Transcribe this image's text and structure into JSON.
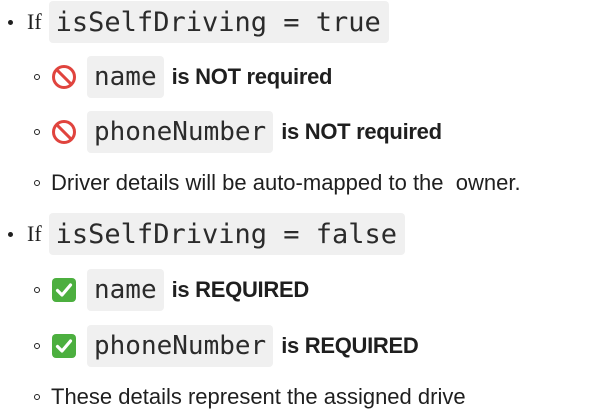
{
  "sections": [
    {
      "if_label": "If",
      "condition": "isSelfDriving = true",
      "items": [
        {
          "icon": "prohibited-icon",
          "field": "name",
          "status": "is NOT required"
        },
        {
          "icon": "prohibited-icon",
          "field": "phoneNumber",
          "status": "is NOT required"
        }
      ],
      "note": "Driver details will be auto-mapped to the  owner."
    },
    {
      "if_label": "If",
      "condition": "isSelfDriving = false",
      "items": [
        {
          "icon": "check-mark-icon",
          "field": "name",
          "status": "is REQUIRED"
        },
        {
          "icon": "check-mark-icon",
          "field": "phoneNumber",
          "status": "is REQUIRED"
        }
      ],
      "note": "These details represent the assigned drive"
    }
  ],
  "colors": {
    "prohibited": "#e0443e",
    "check_bg": "#4caf3f",
    "code_bg": "#f0f0f0"
  }
}
